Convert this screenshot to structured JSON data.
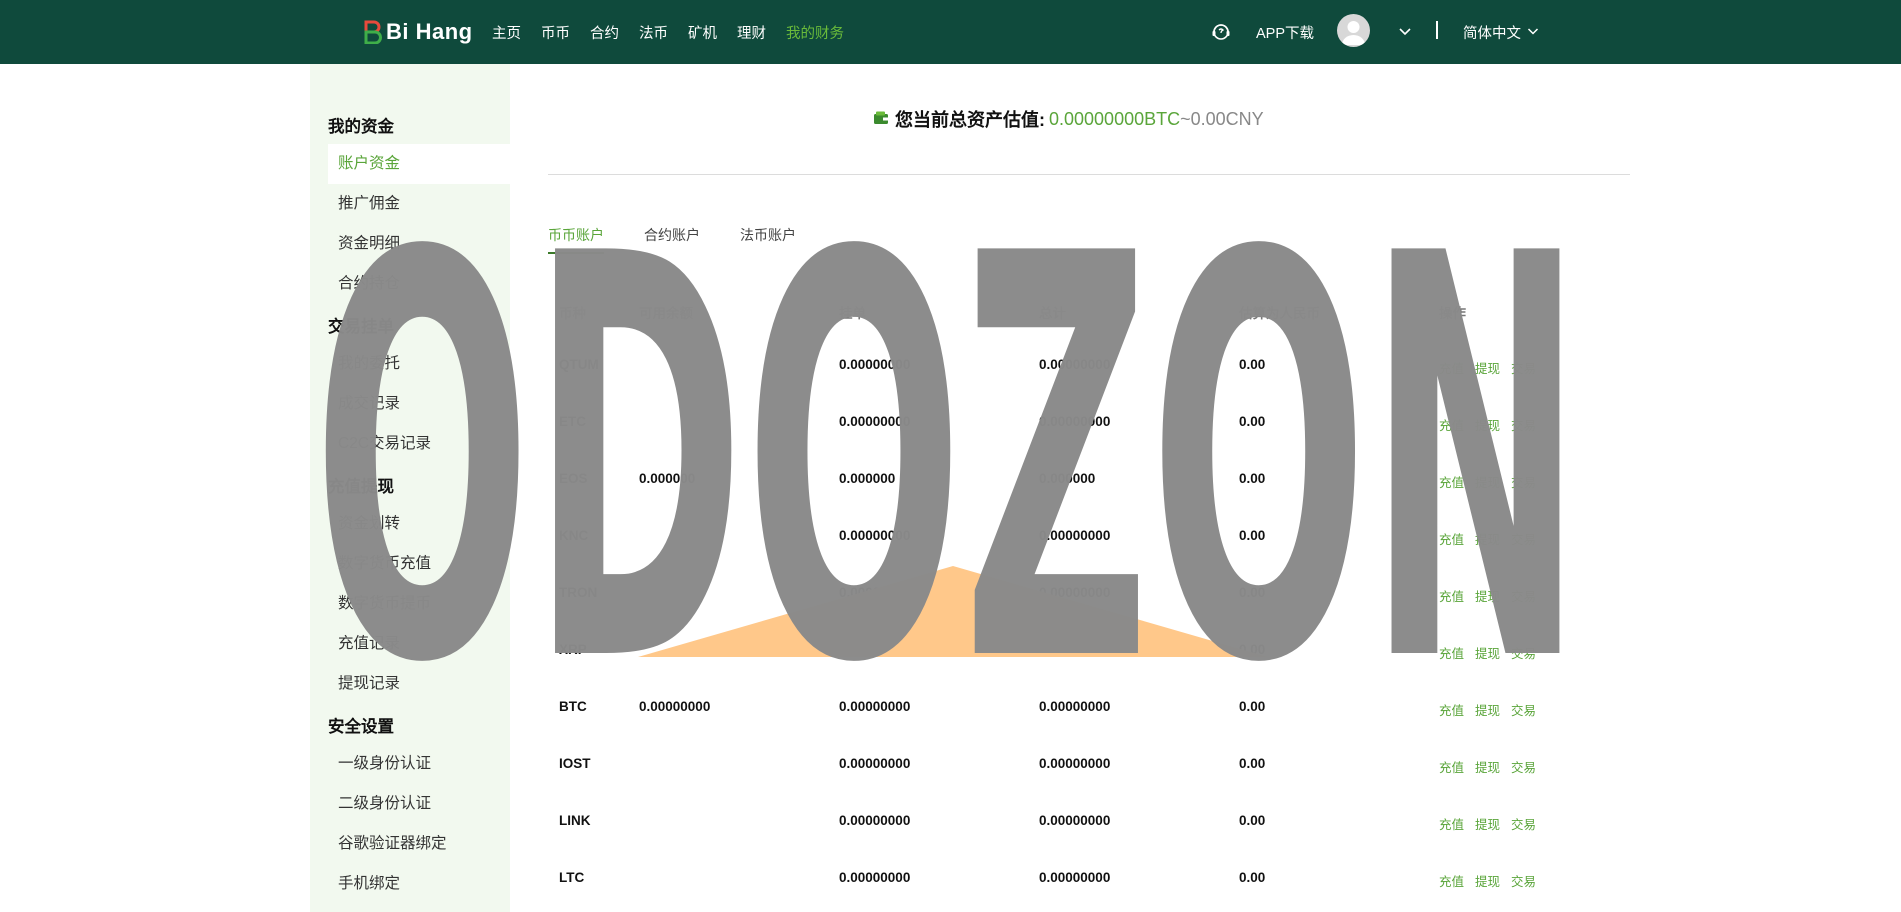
{
  "header": {
    "logo_text": "Bi Hang",
    "nav": [
      "主页",
      "币币",
      "合约",
      "法币",
      "矿机",
      "理财",
      "我的财务"
    ],
    "active_nav_index": 6,
    "app_download": "APP下载",
    "language": "简体中文",
    "colors": {
      "bar": "#0f4a3c",
      "active": "#6abb3a"
    }
  },
  "sidebar": {
    "sections": [
      {
        "title": "我的资金",
        "items": [
          "账户资金",
          "推广佣金",
          "资金明细",
          "合约持仓"
        ]
      },
      {
        "title": "交易挂单",
        "items": [
          "我的委托",
          "成交记录",
          "C2C交易记录"
        ]
      },
      {
        "title": "充值提现",
        "items": [
          "资金划转",
          "数字货币充值",
          "数字货币提币",
          "充值记录",
          "提现记录"
        ]
      },
      {
        "title": "安全设置",
        "items": [
          "一级身份认证",
          "二级身份认证",
          "谷歌验证器绑定",
          "手机绑定"
        ]
      }
    ],
    "active_item": "账户资金"
  },
  "summary": {
    "label": "您当前总资产估值:",
    "btc": "0.00000000BTC",
    "tilde": "~",
    "cny": "0.00CNY"
  },
  "tabs": [
    "币币账户",
    "合约账户",
    "法币账户"
  ],
  "active_tab": 0,
  "table": {
    "headers": [
      "币种",
      "可用余额",
      "挂单",
      "总计",
      "估算为人民币",
      "操作"
    ],
    "actions": [
      "充值",
      "提现",
      "交易"
    ],
    "rows": [
      {
        "coin": "QTUM",
        "available": "",
        "orders": "0.00000000",
        "total": "0.00000000",
        "cny": "0.00"
      },
      {
        "coin": "ETC",
        "available": "",
        "orders": "0.00000000",
        "total": "0.00000000",
        "cny": "0.00"
      },
      {
        "coin": "EOS",
        "available": "0.000000",
        "orders": "0.000000",
        "total": "0.000000",
        "cny": "0.00"
      },
      {
        "coin": "KNC",
        "available": "",
        "orders": "0.00000000",
        "total": "0.00000000",
        "cny": "0.00"
      },
      {
        "coin": "TRON",
        "available": "",
        "orders": "0.00000000",
        "total": "0.00000000",
        "cny": "0.00"
      },
      {
        "coin": "XRP",
        "available": "",
        "orders": "0.00000000",
        "total": "0.00000000",
        "cny": "0.00"
      },
      {
        "coin": "BTC",
        "available": "0.00000000",
        "orders": "0.00000000",
        "total": "0.00000000",
        "cny": "0.00"
      },
      {
        "coin": "IOST",
        "available": "",
        "orders": "0.00000000",
        "total": "0.00000000",
        "cny": "0.00"
      },
      {
        "coin": "LINK",
        "available": "",
        "orders": "0.00000000",
        "total": "0.00000000",
        "cny": "0.00"
      },
      {
        "coin": "LTC",
        "available": "",
        "orders": "0.00000000",
        "total": "0.00000000",
        "cny": "0.00"
      }
    ]
  },
  "watermark": {
    "text": "ODOZON",
    "color": "#8a8a8a",
    "triangle_color": "#ffc88a"
  }
}
